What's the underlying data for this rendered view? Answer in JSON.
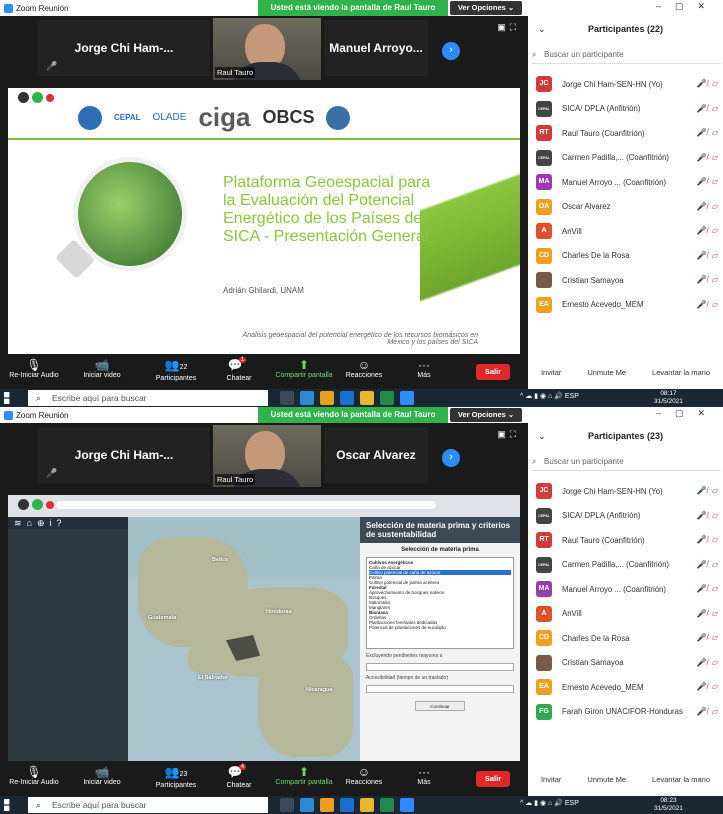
{
  "shots": [
    {
      "window_title": "Zoom Reunión",
      "banner": "Usted está viendo la pantalla de Raul Tauro",
      "view_options": "Ver Opciones ⌄",
      "gallery": {
        "left": "Jorge Chi Ham-...",
        "center": "Raul Tauro",
        "right": "Manuel Arroyo..."
      },
      "slide": {
        "title": "Plataforma Geoespacial para la Evaluación del Potencial Energético de los Países del SICA - Presentación General",
        "author": "Adrián Ghilardi, UNAM",
        "footer": "Análisis geoespacial del potencial energético de los recursos biomásicos en México y los países del SICA",
        "logos": [
          "CEPAL",
          "OLADE",
          "ciga",
          "OBCS"
        ]
      },
      "toolbar": {
        "audio": "Re-Iniciar Audio",
        "video": "Iniciar video",
        "participants": "Participantes",
        "participants_count": "22",
        "chat": "Chatear",
        "chat_badge": "1",
        "share": "Compartir pantalla",
        "reactions": "Reacciones",
        "more": "Más",
        "leave": "Salir"
      },
      "taskbar": {
        "search": "Escribe aquí para buscar",
        "lang": "ESP",
        "time": "08:17",
        "date": "31/5/2021"
      },
      "participants": {
        "title": "Participantes (22)",
        "search_placeholder": "Buscar un participante",
        "list": [
          {
            "initials": "JC",
            "color": "#d13b3b",
            "name": "Jorge Chi Ham-SEN-HN (Yo)"
          },
          {
            "initials": "CEPAL",
            "color": "#444444",
            "name": "SICA/ DPLA (Anfitrión)"
          },
          {
            "initials": "RT",
            "color": "#d13b3b",
            "name": "Raul Tauro (Coanfitrión)"
          },
          {
            "initials": "CEPAL",
            "color": "#444444",
            "name": "Carmen Padilla,... (Coanfitrión)"
          },
          {
            "initials": "MA",
            "color": "#9b3bb0",
            "name": "Manuel Arroyo ... (Coanfitrión)"
          },
          {
            "initials": "OA",
            "color": "#f0a020",
            "name": "Oscar Alvarez"
          },
          {
            "initials": "A",
            "color": "#e0532a",
            "name": "AnVill"
          },
          {
            "initials": "CD",
            "color": "#f0a020",
            "name": "Charles De la Rosa"
          },
          {
            "initials": "",
            "color": "#7a5a44",
            "name": "Cristian Samayoa"
          },
          {
            "initials": "EA",
            "color": "#f0a020",
            "name": "Ernesto Acevedo_MEM"
          }
        ],
        "invite": "Invitar",
        "unmute": "Unmute Me",
        "raise": "Levantar la mano"
      }
    },
    {
      "window_title": "Zoom Reunión",
      "banner": "Usted está viendo la pantalla de Raul Tauro",
      "view_options": "Ver Opciones ⌄",
      "gallery": {
        "left": "Jorge Chi Ham-...",
        "center": "Raul Tauro",
        "right": "Oscar Alvarez"
      },
      "mapapp": {
        "panel_title": "Selección de materia prima y criterios de sustentabilidad",
        "panel_sub": "Selección de materia prima",
        "options": [
          "Cultivos energéticos",
          "Caña de azúcar",
          "Cultivo potencial de caña de azúcar",
          "Palma",
          "Cultivo potencial de palma aceitera",
          "Forestal",
          "Aprovechamiento de bosques nativos",
          "Bosques",
          "Matorrales",
          "Manglares",
          "Biomasa",
          "Ordeñas",
          "Plantaciones forestales dedicadas",
          "Potencial de plantaciones de eucalipto"
        ],
        "f1": "Excluyendo pendientes mayores a",
        "f2": "Accesibilidad (tiempo de un traslado)",
        "btn": "Continuar",
        "map_labels": [
          "Belice",
          "Guatemala",
          "Honduras",
          "El Salvador",
          "Nicaragua"
        ]
      },
      "toolbar": {
        "audio": "Re-Iniciar Audio",
        "video": "Iniciar video",
        "participants": "Participantes",
        "participants_count": "23",
        "chat": "Chatear",
        "chat_badge": "4",
        "share": "Compartir pantalla",
        "reactions": "Reacciones",
        "more": "Más",
        "leave": "Salir"
      },
      "taskbar": {
        "search": "Escribe aquí para buscar",
        "lang": "ESP",
        "time": "08:23",
        "date": "31/5/2021"
      },
      "participants": {
        "title": "Participantes (23)",
        "search_placeholder": "Buscar un participante",
        "list": [
          {
            "initials": "JC",
            "color": "#d13b3b",
            "name": "Jorge Chi Ham-SEN-HN (Yo)"
          },
          {
            "initials": "CEPAL",
            "color": "#444444",
            "name": "SICA/ DPLA (Anfitrión)"
          },
          {
            "initials": "RT",
            "color": "#d13b3b",
            "name": "Raul Tauro (Coanfitrión)"
          },
          {
            "initials": "CEPAL",
            "color": "#444444",
            "name": "Carmen Padilla,... (Coanfitrión)"
          },
          {
            "initials": "MA",
            "color": "#9b3bb0",
            "name": "Manuel Arroyo ... (Coanfitrión)"
          },
          {
            "initials": "A",
            "color": "#e0532a",
            "name": "AnVill"
          },
          {
            "initials": "CD",
            "color": "#f0a020",
            "name": "Charles De la Rosa"
          },
          {
            "initials": "",
            "color": "#7a5a44",
            "name": "Cristian Samayoa"
          },
          {
            "initials": "EA",
            "color": "#f0a020",
            "name": "Ernesto Acevedo_MEM"
          },
          {
            "initials": "FG",
            "color": "#2fa84f",
            "name": "Farah Giron UNACIFOR-Honduras"
          }
        ],
        "invite": "Invitar",
        "unmute": "Unmute Me",
        "raise": "Levantar la mano"
      }
    }
  ]
}
